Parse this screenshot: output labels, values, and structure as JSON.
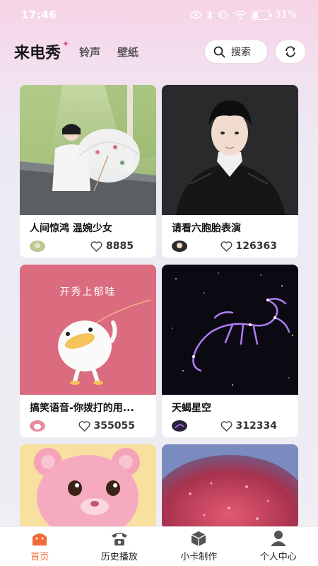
{
  "status_bar": {
    "time": "17:46",
    "battery": "31%",
    "battery_level": 0.31
  },
  "header": {
    "logo": "来电秀",
    "tabs": [
      "铃声",
      "壁纸"
    ],
    "search_label": "搜索"
  },
  "cards": [
    {
      "title": "人间惊鸿 温婉少女",
      "likes": "8885"
    },
    {
      "title": "请看六胞胎表演",
      "likes": "126363"
    },
    {
      "title": "搞笑语音-你拨打的用...",
      "likes": "355055",
      "image_text": "开秀上郁哇"
    },
    {
      "title": "天蝎星空",
      "likes": "312334"
    }
  ],
  "bottom_nav": [
    {
      "label": "首页",
      "icon": "home-icon",
      "active": true
    },
    {
      "label": "历史播放",
      "icon": "phone-icon",
      "active": false
    },
    {
      "label": "小卡制作",
      "icon": "box-icon",
      "active": false
    },
    {
      "label": "个人中心",
      "icon": "user-icon",
      "active": false
    }
  ],
  "colors": {
    "accent": "#f06a3a",
    "brand_pink": "#e14a8a"
  }
}
